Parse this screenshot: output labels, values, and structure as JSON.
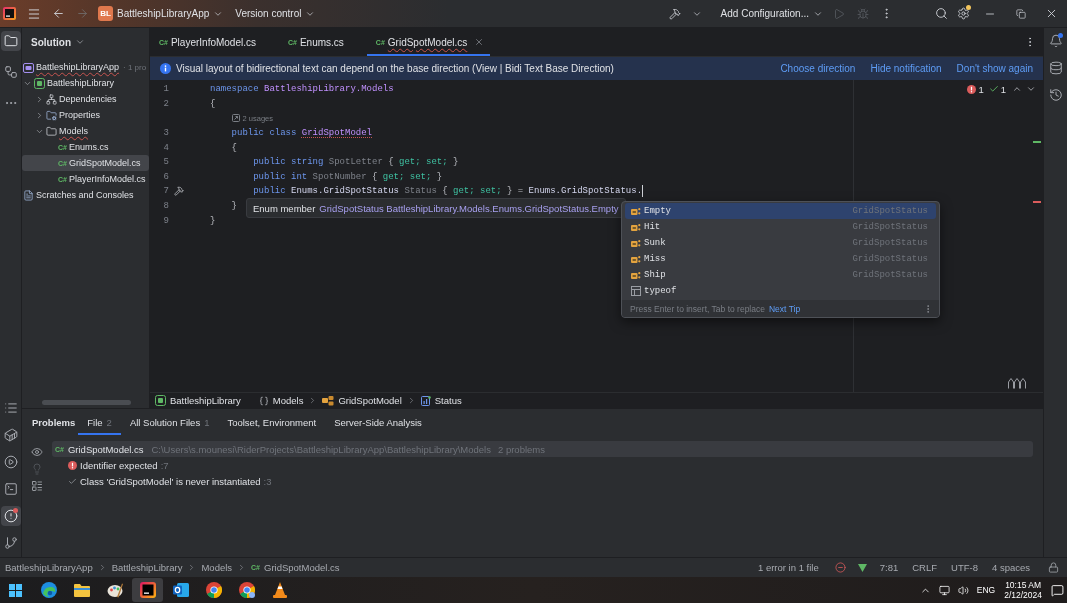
{
  "title_bar": {
    "project_badge": "BL",
    "project": "BattleshipLibraryApp",
    "version_control": "Version control",
    "run_configuration": "Add Configuration...",
    "forward_enabled": false,
    "run_enabled": false,
    "settings_badge": true
  },
  "left_toolbar": {
    "top": [
      {
        "selected": true
      },
      {
        "selected": false
      },
      {
        "selected": false
      }
    ],
    "bottom": [
      {
        "selected": false,
        "alert": false
      },
      {
        "selected": false,
        "alert": false
      },
      {
        "selected": false,
        "alert": false
      },
      {
        "selected": false,
        "alert": false
      },
      {
        "selected": true,
        "alert": true
      },
      {
        "selected": false,
        "alert": false
      }
    ]
  },
  "project_panel": {
    "title": "Solution",
    "tree": [
      {
        "kind": "solution",
        "label": "BattleshipLibraryApp",
        "note": "· 1 pro",
        "has_error": true,
        "selected": false,
        "children": [
          {
            "kind": "project",
            "label": "BattleshipLibrary",
            "has_error": false,
            "expanded": true,
            "selected": false,
            "children": [
              {
                "kind": "dependencies",
                "label": "Dependencies",
                "has_error": false,
                "expanded": false,
                "selected": false
              },
              {
                "kind": "properties",
                "label": "Properties",
                "has_error": false,
                "expanded": false,
                "selected": false
              },
              {
                "kind": "folder",
                "label": "Models",
                "has_error": true,
                "expanded": true,
                "selected": false,
                "children": [
                  {
                    "kind": "file",
                    "file_type": "C#",
                    "label": "Enums.cs",
                    "has_error": false,
                    "selected": false
                  },
                  {
                    "kind": "file",
                    "file_type": "C#",
                    "label": "GridSpotModel.cs",
                    "has_error": false,
                    "selected": true
                  },
                  {
                    "kind": "file",
                    "file_type": "C#",
                    "label": "PlayerInfoModel.cs",
                    "has_error": false,
                    "selected": false
                  }
                ]
              }
            ]
          }
        ]
      },
      {
        "kind": "scratches",
        "label": "Scratches and Consoles",
        "has_error": false,
        "selected": false
      }
    ]
  },
  "editor_tabs": [
    {
      "file_type": "C#",
      "label": "PlayerInfoModel.cs",
      "has_error": false,
      "selected": false
    },
    {
      "file_type": "C#",
      "label": "Enums.cs",
      "has_error": false,
      "selected": false
    },
    {
      "file_type": "C#",
      "label": "GridSpotModel.cs",
      "has_error": true,
      "selected": true
    }
  ],
  "notification": {
    "text": "Visual layout of bidirectional text can depend on the base direction (View | Bidi Text Base Direction)",
    "actions": [
      "Choose direction",
      "Hide notification",
      "Don't show again"
    ]
  },
  "inspections": {
    "errors": "1",
    "warnings": "1"
  },
  "code": {
    "lines": [
      {
        "kind": "code",
        "number": "1",
        "current": false,
        "tokens": [
          {
            "kind": "keyword",
            "text": "namespace"
          },
          {
            "kind": "namespace",
            "text": "BattleshipLibrary.Models"
          }
        ]
      },
      {
        "kind": "code",
        "number": "2",
        "current": false,
        "tokens": [
          {
            "kind": "punct",
            "text": "{"
          }
        ],
        "children": [
          {
            "kind": "hint",
            "text": "2 usages",
            "current": false
          },
          {
            "kind": "code",
            "number": "3",
            "current": false,
            "tokens": [
              {
                "kind": "keyword",
                "text": "public"
              },
              {
                "kind": "keyword",
                "text": "class"
              },
              {
                "kind": "flagged",
                "text": "GridSpotModel"
              }
            ]
          },
          {
            "kind": "code",
            "number": "4",
            "current": false,
            "tokens": [
              {
                "kind": "punct",
                "text": "{"
              }
            ],
            "children": [
              {
                "kind": "code",
                "number": "5",
                "current": false,
                "tokens": [
                  {
                    "kind": "keyword",
                    "text": "public"
                  },
                  {
                    "kind": "keyword",
                    "text": "string"
                  },
                  {
                    "kind": "member",
                    "text": "SpotLetter"
                  },
                  {
                    "kind": "punct",
                    "text": "{"
                  },
                  {
                    "kind": "accessor",
                    "text": "get;"
                  },
                  {
                    "kind": "accessor",
                    "text": "set;"
                  },
                  {
                    "kind": "punct",
                    "text": "}"
                  }
                ]
              },
              {
                "kind": "code",
                "number": "6",
                "current": false,
                "tokens": [
                  {
                    "kind": "keyword",
                    "text": "public"
                  },
                  {
                    "kind": "keyword",
                    "text": "int"
                  },
                  {
                    "kind": "member",
                    "text": "SpotNumber"
                  },
                  {
                    "kind": "punct",
                    "text": "{"
                  },
                  {
                    "kind": "accessor",
                    "text": "get;"
                  },
                  {
                    "kind": "accessor",
                    "text": "set;"
                  },
                  {
                    "kind": "punct",
                    "text": "}"
                  }
                ]
              },
              {
                "kind": "code",
                "number": "7",
                "current": true,
                "tokens": [
                  {
                    "kind": "keyword",
                    "text": "public"
                  },
                  {
                    "kind": "type",
                    "text": "Enums.GridSpotStatus"
                  },
                  {
                    "kind": "member",
                    "text": "Status"
                  },
                  {
                    "kind": "punct",
                    "text": "{"
                  },
                  {
                    "kind": "accessor",
                    "text": "get;"
                  },
                  {
                    "kind": "accessor",
                    "text": "set;"
                  },
                  {
                    "kind": "punct",
                    "text": "}"
                  },
                  {
                    "kind": "punct",
                    "text": "="
                  },
                  {
                    "kind": "type",
                    "text": "Enums.GridSpotStatus."
                  }
                ]
              }
            ]
          },
          {
            "kind": "code",
            "number": "8",
            "current": false,
            "tokens": [
              {
                "kind": "punct",
                "text": "}"
              }
            ]
          }
        ]
      },
      {
        "kind": "code",
        "number": "9",
        "current": false,
        "tokens": [
          {
            "kind": "punct",
            "text": "}"
          }
        ]
      }
    ]
  },
  "tooltip": {
    "label": "Enum member",
    "signature": "GridSpotStatus BattleshipLibrary.Models.Enums.GridSpotStatus.Empty"
  },
  "completion": {
    "items": [
      {
        "kind": "enum-member",
        "label": "Empty",
        "type": "GridSpotStatus",
        "selected": true
      },
      {
        "kind": "enum-member",
        "label": "Hit",
        "type": "GridSpotStatus",
        "selected": false
      },
      {
        "kind": "enum-member",
        "label": "Sunk",
        "type": "GridSpotStatus",
        "selected": false
      },
      {
        "kind": "enum-member",
        "label": "Miss",
        "type": "GridSpotStatus",
        "selected": false
      },
      {
        "kind": "enum-member",
        "label": "Ship",
        "type": "GridSpotStatus",
        "selected": false
      },
      {
        "kind": "keyword",
        "label": "typeof",
        "selected": false
      }
    ],
    "hint": "Press Enter to insert, Tab to replace",
    "hint_link": "Next Tip"
  },
  "breadcrumbs": {
    "project": "BattleshipLibrary",
    "path": [
      {
        "kind": "namespace",
        "label": "Models"
      },
      {
        "kind": "class",
        "label": "GridSpotModel"
      },
      {
        "kind": "property",
        "label": "Status"
      }
    ]
  },
  "right_toolbar": {
    "notifications_badge": true
  },
  "problems": {
    "title": "Problems",
    "tabs": [
      {
        "label": "File",
        "count": "2",
        "selected": true
      },
      {
        "label": "All Solution Files",
        "count": "1",
        "selected": false
      },
      {
        "label": "Toolset, Environment",
        "selected": false
      },
      {
        "label": "Server-Side Analysis",
        "selected": false
      }
    ],
    "file": {
      "file_type": "C#",
      "name": "GridSpotModel.cs",
      "path": "C:\\Users\\s.mounesi\\RiderProjects\\BattleshipLibraryApp\\BattleshipLibrary\\Models",
      "summary": "2 problems",
      "selected": true,
      "items": [
        {
          "kind": "error",
          "message": "Identifier expected",
          "location": ":7"
        },
        {
          "kind": "suggestion",
          "message": "Class 'GridSpotModel' is never instantiated",
          "location": ":3"
        }
      ]
    }
  },
  "status_bar": {
    "path": [
      {
        "label": "BattleshipLibraryApp"
      },
      {
        "label": "BattleshipLibrary"
      },
      {
        "label": "Models"
      },
      {
        "file_type": "C#",
        "label": "GridSpotModel.cs"
      }
    ],
    "problems": "1 error in 1 file",
    "position": "7:81",
    "line_separator": "CRLF",
    "encoding": "UTF-8",
    "indent": "4 spaces"
  },
  "taskbar": {
    "apps": [
      {
        "selected": false
      },
      {
        "selected": false
      },
      {
        "selected": false
      },
      {
        "selected": true
      },
      {
        "selected": false
      },
      {
        "selected": false
      },
      {
        "selected": false
      },
      {
        "selected": false
      }
    ],
    "language": "ENG",
    "time": "10:15 AM",
    "date": "2/12/2024"
  }
}
